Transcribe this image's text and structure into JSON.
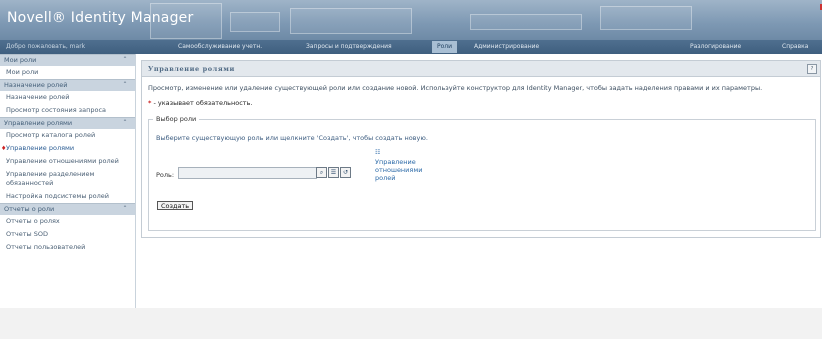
{
  "app": {
    "title": "Novell® Identity Manager"
  },
  "nav": {
    "welcome": "Добро пожаловать, mark",
    "tabs": [
      "Самообслуживание учетн.",
      "Запросы и подтверждения",
      "Роли",
      "Администрирование"
    ],
    "right_links": [
      "Разлогирование",
      "Справка"
    ]
  },
  "sidebar": {
    "sections": [
      {
        "title": "Мои роли",
        "items": [
          "Мои роли"
        ]
      },
      {
        "title": "Назначение ролей",
        "items": [
          "Назначение ролей",
          "Просмотр состояния запроса"
        ]
      },
      {
        "title": "Управление ролями",
        "items": [
          "Просмотр каталога ролей",
          "Управление ролями",
          "Управление отношениями ролей",
          "Управление разделением обязанностей",
          "Настройка подсистемы ролей"
        ]
      },
      {
        "title": "Отчеты о роли",
        "items": [
          "Отчеты о ролях",
          "Отчеты SOD",
          "Отчеты пользователей"
        ]
      }
    ]
  },
  "main": {
    "title": "Управление ролями",
    "help_icon": "help-icon",
    "description": "Просмотр, изменение или удаление существующей роли или создание новой. Используйте конструктор для Identity Manager, чтобы задать наделения правами и их параметры.",
    "required_mark": "*",
    "required_text": " - указывает обязательность.",
    "fieldset": {
      "legend": "Выбор роли",
      "hint": "Выберите существующую роль или щелкните 'Создать', чтобы создать новую.",
      "role_label": "Роль:",
      "role_value": "",
      "relations_link": "Управление отношениями ролей",
      "create_button": "Создать"
    }
  }
}
